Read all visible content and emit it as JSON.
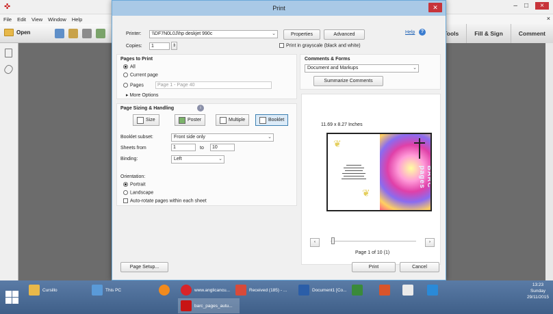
{
  "app": {
    "menu": [
      "File",
      "Edit",
      "View",
      "Window",
      "Help"
    ],
    "open_label": "Open",
    "right_tabs": [
      "Tools",
      "Fill & Sign",
      "Comment"
    ]
  },
  "dialog": {
    "title": "Print",
    "help_label": "Help",
    "printer_label": "Printer:",
    "printer_value": "\\\\DF7N0L0J\\hp deskjet 990c",
    "properties_label": "Properties",
    "advanced_label": "Advanced",
    "copies_label": "Copies:",
    "copies_value": "1",
    "grayscale_label": "Print in grayscale (black and white)",
    "pages_title": "Pages to Print",
    "radio_all": "All",
    "radio_current": "Current page",
    "radio_pages": "Pages",
    "pages_range": "Page 1 - Page 40",
    "more_options": "More Options",
    "sizing_title": "Page Sizing & Handling",
    "size_btns": [
      "Size",
      "Poster",
      "Multiple",
      "Booklet"
    ],
    "booklet_subset_label": "Booklet subset:",
    "booklet_subset_value": "Front side only",
    "sheets_from_label": "Sheets from",
    "sheets_from_value": "1",
    "sheets_to_label": "to",
    "sheets_to_value": "10",
    "binding_label": "Binding:",
    "binding_value": "Left",
    "orientation_label": "Orientation:",
    "portrait_label": "Portrait",
    "landscape_label": "Landscape",
    "autorotate_label": "Auto-rotate pages within each sheet",
    "comments_title": "Comments & Forms",
    "comments_value": "Document and Markups",
    "summarize_label": "Summarize Comments",
    "paper_size": "11.69 x 8.27 Inches",
    "page_indicator": "Page 1 of 10 (1)",
    "page_setup_label": "Page Setup...",
    "print_label": "Print",
    "cancel_label": "Cancel",
    "preview_right_text": "BARC pages"
  },
  "taskbar": {
    "items": [
      {
        "label": "Cursillo",
        "color": "#e8b84a"
      },
      {
        "label": "This PC",
        "color": "#5a9ad8"
      },
      {
        "label": "",
        "color": "#f08a1e"
      },
      {
        "label": "www.anglicancu...",
        "color": "#d8242a"
      },
      {
        "label": "Received (185) - ...",
        "color": "#d84a3a"
      },
      {
        "label": "Document1 [Co...",
        "color": "#2b5ea8"
      },
      {
        "label": "",
        "color": "#3a8a3a"
      },
      {
        "label": "",
        "color": "#d8542a"
      },
      {
        "label": "",
        "color": "#eaeaea"
      },
      {
        "label": "",
        "color": "#2a8ad8"
      },
      {
        "label": "barc_pages_autu...",
        "color": "#c81414"
      }
    ],
    "time": "13:23",
    "day": "Sunday",
    "date": "29/11/2015"
  }
}
